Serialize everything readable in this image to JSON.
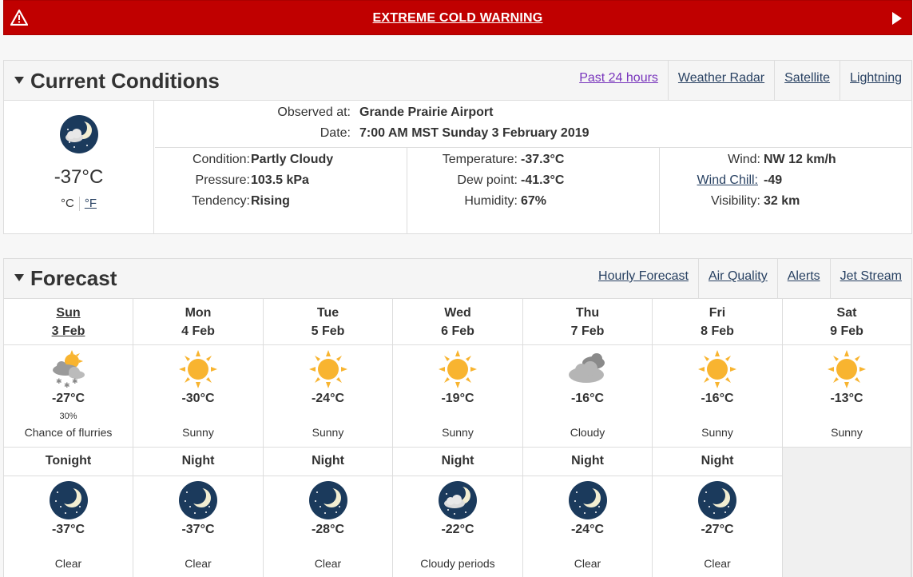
{
  "warning": {
    "text": "EXTREME COLD WARNING"
  },
  "current": {
    "title": "Current Conditions",
    "links": [
      "Past 24 hours",
      "Weather Radar",
      "Satellite",
      "Lightning"
    ],
    "temp": "-37°C",
    "unit_c": "°C",
    "unit_f": "°F",
    "observed_label": "Observed at:",
    "observed_value": "Grande Prairie Airport",
    "date_label": "Date:",
    "date_value": "7:00 AM MST Sunday 3 February 2019",
    "col1": [
      {
        "label": "Condition:",
        "value": "Partly Cloudy"
      },
      {
        "label": "Pressure:",
        "value": "103.5 kPa"
      },
      {
        "label": "Tendency:",
        "value": "Rising"
      }
    ],
    "col2": [
      {
        "label": "Temperature:",
        "value": "-37.3°C"
      },
      {
        "label": "Dew point:",
        "value": "-41.3°C"
      },
      {
        "label": "Humidity:",
        "value": "67%"
      }
    ],
    "col3": [
      {
        "label": "Wind:",
        "value": "NW 12 km/h"
      },
      {
        "label": "Wind Chill:",
        "value": "-49"
      },
      {
        "label": "Visibility:",
        "value": "32 km"
      }
    ]
  },
  "forecast": {
    "title": "Forecast",
    "links": [
      "Hourly Forecast",
      "Air Quality",
      "Alerts",
      "Jet Stream"
    ],
    "days": [
      {
        "day": "Sun",
        "date": "3 Feb",
        "icon": "sun-cloud-snow-icon",
        "temp": "-27°C",
        "pop": "30%",
        "cond": "Chance of flurries"
      },
      {
        "day": "Mon",
        "date": "4 Feb",
        "icon": "sun-icon",
        "temp": "-30°C",
        "pop": "",
        "cond": "Sunny"
      },
      {
        "day": "Tue",
        "date": "5 Feb",
        "icon": "sun-icon",
        "temp": "-24°C",
        "pop": "",
        "cond": "Sunny"
      },
      {
        "day": "Wed",
        "date": "6 Feb",
        "icon": "sun-icon",
        "temp": "-19°C",
        "pop": "",
        "cond": "Sunny"
      },
      {
        "day": "Thu",
        "date": "7 Feb",
        "icon": "cloud-icon",
        "temp": "-16°C",
        "pop": "",
        "cond": "Cloudy"
      },
      {
        "day": "Fri",
        "date": "8 Feb",
        "icon": "sun-icon",
        "temp": "-16°C",
        "pop": "",
        "cond": "Sunny"
      },
      {
        "day": "Sat",
        "date": "9 Feb",
        "icon": "sun-icon",
        "temp": "-13°C",
        "pop": "",
        "cond": "Sunny"
      }
    ],
    "nights": [
      {
        "label": "Tonight",
        "icon": "moon-icon",
        "temp": "-37°C",
        "cond": "Clear"
      },
      {
        "label": "Night",
        "icon": "moon-icon",
        "temp": "-37°C",
        "cond": "Clear"
      },
      {
        "label": "Night",
        "icon": "moon-icon",
        "temp": "-28°C",
        "cond": "Clear"
      },
      {
        "label": "Night",
        "icon": "moon-cloud-icon",
        "temp": "-22°C",
        "cond": "Cloudy periods"
      },
      {
        "label": "Night",
        "icon": "moon-icon",
        "temp": "-24°C",
        "cond": "Clear"
      },
      {
        "label": "Night",
        "icon": "moon-icon",
        "temp": "-27°C",
        "cond": "Clear"
      }
    ]
  },
  "colors": {
    "warning": "#c00000",
    "link": "#284162",
    "visited": "#7834bc",
    "sun": "#f8b430",
    "night": "#1b3a5c"
  }
}
